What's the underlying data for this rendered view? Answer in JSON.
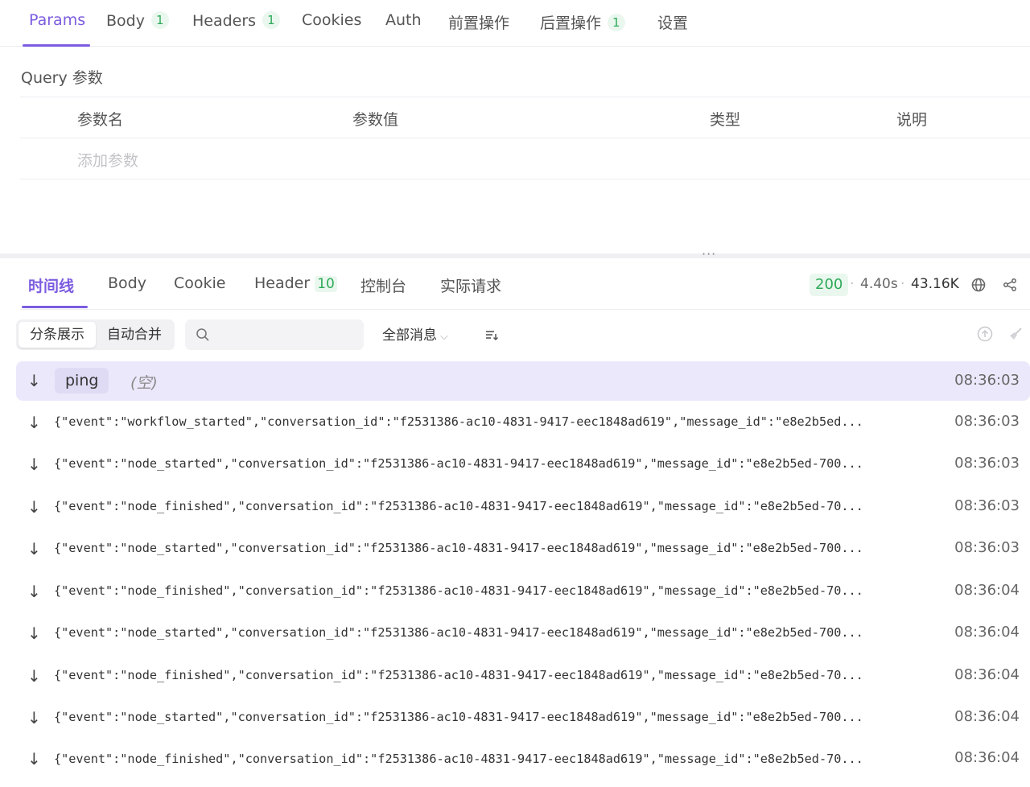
{
  "request_tabs": [
    {
      "label": "Params",
      "count": ""
    },
    {
      "label": "Body",
      "count": "1"
    },
    {
      "label": "Headers",
      "count": "1"
    },
    {
      "label": "Cookies",
      "count": ""
    },
    {
      "label": "Auth",
      "count": ""
    },
    {
      "label": "前置操作",
      "count": ""
    },
    {
      "label": "后置操作",
      "count": "1"
    },
    {
      "label": "设置",
      "count": ""
    }
  ],
  "query": {
    "title": "Query 参数",
    "columns": [
      "参数名",
      "参数值",
      "类型",
      "说明"
    ],
    "add_placeholder": "添加参数"
  },
  "splitter_handle": "···",
  "response_tabs": [
    {
      "label": "时间线",
      "count": ""
    },
    {
      "label": "Body",
      "count": ""
    },
    {
      "label": "Cookie",
      "count": ""
    },
    {
      "label": "Header",
      "count": "10"
    },
    {
      "label": "控制台",
      "count": ""
    },
    {
      "label": "实际请求",
      "count": ""
    }
  ],
  "response_meta": {
    "status": "200",
    "time": "4.40s",
    "size": "43.16K",
    "separator": "·"
  },
  "toolbar": {
    "view_modes": [
      "分条展示",
      "自动合并"
    ],
    "search_placeholder": "",
    "filter_label": "全部消息",
    "filter_chevron": "⌵"
  },
  "colors": {
    "accent": "#7c5ce0",
    "success": "#2faa5a",
    "ping_row_bg": "#ece8fb"
  },
  "icons": {
    "arrow": "↓",
    "globe": "globe-icon",
    "share": "share-icon",
    "sort": "sort-icon",
    "scroll_top": "upload-circle-icon",
    "clear": "broom-icon"
  },
  "messages": [
    {
      "type": "ping",
      "label": "ping",
      "content": "(空)",
      "time": "08:36:03"
    },
    {
      "type": "data",
      "content": "{\"event\":\"workflow_started\",\"conversation_id\":\"f2531386-ac10-4831-9417-eec1848ad619\",\"message_id\":\"e8e2b5ed...",
      "time": "08:36:03"
    },
    {
      "type": "data",
      "content": "{\"event\":\"node_started\",\"conversation_id\":\"f2531386-ac10-4831-9417-eec1848ad619\",\"message_id\":\"e8e2b5ed-700...",
      "time": "08:36:03"
    },
    {
      "type": "data",
      "content": "{\"event\":\"node_finished\",\"conversation_id\":\"f2531386-ac10-4831-9417-eec1848ad619\",\"message_id\":\"e8e2b5ed-70...",
      "time": "08:36:03"
    },
    {
      "type": "data",
      "content": "{\"event\":\"node_started\",\"conversation_id\":\"f2531386-ac10-4831-9417-eec1848ad619\",\"message_id\":\"e8e2b5ed-700...",
      "time": "08:36:03"
    },
    {
      "type": "data",
      "content": "{\"event\":\"node_finished\",\"conversation_id\":\"f2531386-ac10-4831-9417-eec1848ad619\",\"message_id\":\"e8e2b5ed-70...",
      "time": "08:36:04"
    },
    {
      "type": "data",
      "content": "{\"event\":\"node_started\",\"conversation_id\":\"f2531386-ac10-4831-9417-eec1848ad619\",\"message_id\":\"e8e2b5ed-700...",
      "time": "08:36:04"
    },
    {
      "type": "data",
      "content": "{\"event\":\"node_finished\",\"conversation_id\":\"f2531386-ac10-4831-9417-eec1848ad619\",\"message_id\":\"e8e2b5ed-70...",
      "time": "08:36:04"
    },
    {
      "type": "data",
      "content": "{\"event\":\"node_started\",\"conversation_id\":\"f2531386-ac10-4831-9417-eec1848ad619\",\"message_id\":\"e8e2b5ed-700...",
      "time": "08:36:04"
    },
    {
      "type": "data",
      "content": "{\"event\":\"node_finished\",\"conversation_id\":\"f2531386-ac10-4831-9417-eec1848ad619\",\"message_id\":\"e8e2b5ed-70...",
      "time": "08:36:04"
    }
  ]
}
